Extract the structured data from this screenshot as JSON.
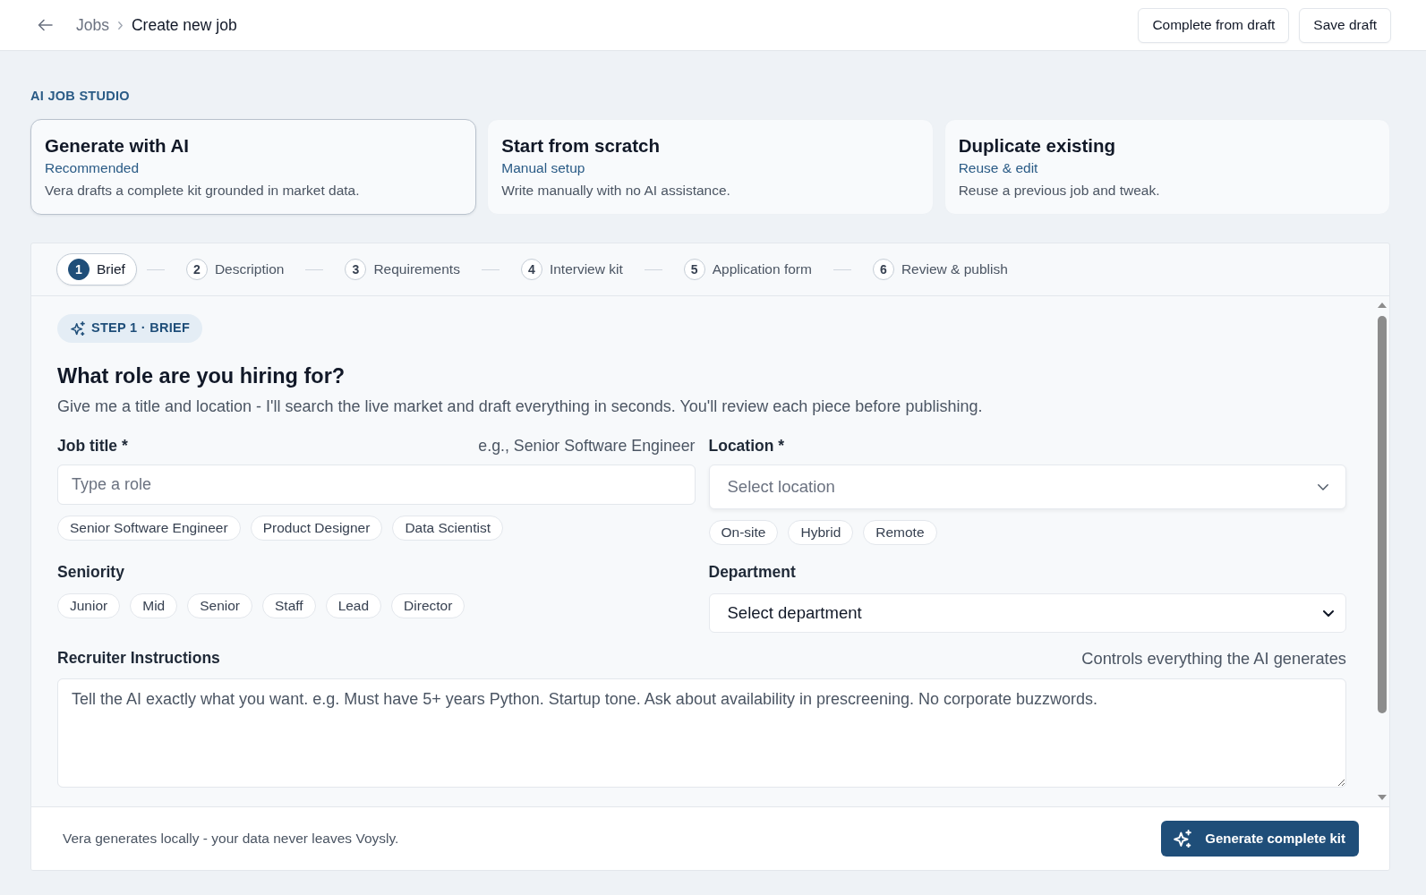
{
  "top_bar": {
    "breadcrumb": [
      {
        "label": "Jobs",
        "kind": "link"
      },
      {
        "label": "Create new job",
        "kind": "current"
      }
    ],
    "actions": [
      {
        "label": "Complete from draft"
      },
      {
        "label": "Save draft"
      }
    ]
  },
  "studio": {
    "eyebrow": "AI JOB STUDIO",
    "modes": [
      {
        "title": "Generate with AI",
        "tag": "Recommended",
        "description": "Vera drafts a complete kit grounded in market data.",
        "selected": true
      },
      {
        "title": "Start from scratch",
        "tag": "Manual setup",
        "description": "Write manually with no AI assistance.",
        "selected": false
      },
      {
        "title": "Duplicate existing",
        "tag": "Reuse & edit",
        "description": "Reuse a previous job and tweak.",
        "selected": false
      }
    ]
  },
  "stepper": {
    "steps": [
      {
        "number": "1",
        "label": "Brief",
        "selected": true
      },
      {
        "number": "2",
        "label": "Description",
        "selected": false
      },
      {
        "number": "3",
        "label": "Requirements",
        "selected": false
      },
      {
        "number": "4",
        "label": "Interview kit",
        "selected": false
      },
      {
        "number": "5",
        "label": "Application form",
        "selected": false
      },
      {
        "number": "6",
        "label": "Review & publish",
        "selected": false
      }
    ]
  },
  "brief": {
    "badge": "STEP 1 · BRIEF",
    "heading": "What role are you hiring for?",
    "intro": "Give me a title and location - I'll search the live market and draft everything in seconds. You'll review each piece before publishing.",
    "job_title": {
      "label": "Job title *",
      "hint": "e.g., Senior Software Engineer",
      "placeholder": "Type a role",
      "suggestions": [
        "Senior Software Engineer",
        "Product Designer",
        "Data Scientist"
      ]
    },
    "location": {
      "label": "Location *",
      "placeholder": "Select location",
      "work_modes": [
        {
          "label": "On-site",
          "selected": false
        },
        {
          "label": "Hybrid",
          "selected": false
        },
        {
          "label": "Remote",
          "selected": false
        }
      ]
    },
    "seniority": {
      "label": "Seniority",
      "levels": [
        {
          "label": "Junior",
          "selected": false
        },
        {
          "label": "Mid",
          "selected": false
        },
        {
          "label": "Senior",
          "selected": false
        },
        {
          "label": "Staff",
          "selected": false
        },
        {
          "label": "Lead",
          "selected": false
        },
        {
          "label": "Director",
          "selected": false
        }
      ]
    },
    "department": {
      "label": "Department",
      "value": "Select department"
    },
    "recruiter_instructions": {
      "label": "Recruiter Instructions",
      "hint": "Controls everything the AI generates",
      "placeholder": "Tell the AI exactly what you want. e.g. Must have 5+ years Python. Startup tone. Ask about availability in prescreening. No corporate buzzwords."
    }
  },
  "footer": {
    "note": "Vera generates locally - your data never leaves Voysly.",
    "button": "Generate complete kit"
  }
}
